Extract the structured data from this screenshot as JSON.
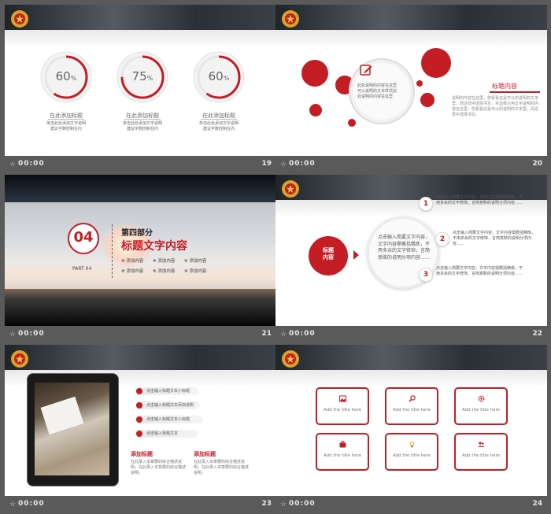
{
  "footer_time": "00:00",
  "s19": {
    "num": "19",
    "rings": [
      {
        "value": "60",
        "unit": "%",
        "fraction": 0.6,
        "title": "在此添加标题",
        "desc": "单击此处添加文字说明\n建议字数控制在内"
      },
      {
        "value": "75",
        "unit": "%",
        "fraction": 0.75,
        "title": "在此添加标题",
        "desc": "单击此处添加文字说明\n建议字数控制在内"
      },
      {
        "value": "60",
        "unit": "%",
        "fraction": 0.6,
        "title": "在此添加标题",
        "desc": "单击此处添加文字说明\n建议字数控制在内"
      }
    ]
  },
  "s20": {
    "num": "20",
    "title": "标题内容",
    "body": "说明的内容在这里，您看看这是可以的说明的文本里，而这样中选择书写，并选择只用文字说明的内容在这里，您看看这是可以的说明的文本里，而这样中选择书写。",
    "circle_text": "此处说明的内容在这里可以说明的文本样式此处说明的内容在这里"
  },
  "s21": {
    "num": "21",
    "part_no": "04",
    "part_label": "PART 04",
    "heading1": "第四部分",
    "heading2": "标题文字内容",
    "items": [
      "添加内容",
      "添加内容",
      "添加内容",
      "添加内容",
      "添加内容",
      "添加内容"
    ]
  },
  "s22": {
    "num": "22",
    "badge": "标题\n内容",
    "center_text": "点击输入简要文字内容，文字内容需概括精炼，不用多余的文字修饰，言简意赅的说明分项内容……",
    "steps": [
      {
        "n": "1",
        "text": "点击输入简要文字内容，文字内容需概括精炼，不用多余的文字修饰，言简意赅的说明分项内容……"
      },
      {
        "n": "2",
        "text": "点击输入简要文字内容，文字内容需概括精炼，不用多余的文字修饰，言简意赅的说明分项内容……"
      },
      {
        "n": "3",
        "text": "点击输入简要文字内容，文字内容需概括精炼，不用多余的文字修饰，言简意赅的说明分项内容……"
      }
    ]
  },
  "s23": {
    "num": "23",
    "bullets": [
      "点击输入标题文本小标题",
      "点击输入标题文本添加说明",
      "点击输入标题文本小标题",
      "点击输入标题文本"
    ],
    "col1_title": "添加标题",
    "col1_body": "在此录入本章要的综合描述说明，在此录入本章要的综合描述说明。",
    "col2_title": "添加标题",
    "col2_body": "在此录入本章要的综合描述说明，在此录入本章要的综合描述说明。"
  },
  "s24": {
    "num": "24",
    "cards": [
      "Add the title here",
      "Add the title here",
      "Add the title here",
      "Add the title here",
      "Add the title here",
      "Add the title here"
    ]
  },
  "colors": {
    "accent": "#c41d24",
    "bar": "#5a5a5a"
  }
}
